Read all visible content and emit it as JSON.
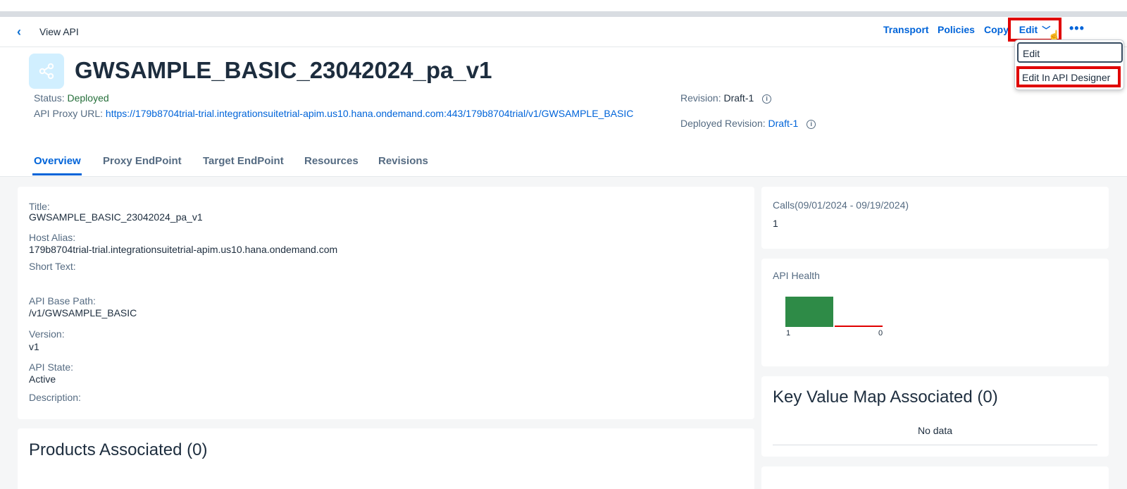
{
  "toolbar": {
    "view_title": "View API",
    "transport": "Transport",
    "policies": "Policies",
    "copy": "Copy",
    "edit": "Edit"
  },
  "dropdown": {
    "items": [
      "Edit",
      "Edit In API Designer"
    ]
  },
  "header": {
    "title": "GWSAMPLE_BASIC_23042024_pa_v1",
    "status_label": "Status:",
    "status_value": "Deployed",
    "proxy_url_label": "API Proxy URL:",
    "proxy_url": "https://179b8704trial-trial.integrationsuitetrial-apim.us10.hana.ondemand.com:443/179b8704trial/v1/GWSAMPLE_BASIC",
    "revision_label": "Revision:",
    "revision_value": "Draft-1",
    "deployed_revision_label": "Deployed Revision:",
    "deployed_revision_value": "Draft-1"
  },
  "tabs": [
    "Overview",
    "Proxy EndPoint",
    "Target EndPoint",
    "Resources",
    "Revisions"
  ],
  "details": {
    "title_label": "Title:",
    "title_value": "GWSAMPLE_BASIC_23042024_pa_v1",
    "host_alias_label": "Host Alias:",
    "host_alias_value": "179b8704trial-trial.integrationsuitetrial-apim.us10.hana.ondemand.com",
    "short_text_label": "Short Text:",
    "base_path_label": "API Base Path:",
    "base_path_value": "/v1/GWSAMPLE_BASIC",
    "version_label": "Version:",
    "version_value": "v1",
    "state_label": "API State:",
    "state_value": "Active",
    "description_label": "Description:"
  },
  "products": {
    "heading": "Products Associated (0)"
  },
  "calls": {
    "label": "Calls(09/01/2024 - 09/19/2024)",
    "value": "1"
  },
  "health": {
    "label": "API Health",
    "success_value": "1",
    "error_value": "0",
    "success_color": "#2e8b47",
    "error_color": "#e00000"
  },
  "kvm": {
    "heading": "Key Value Map Associated (0)",
    "empty_text": "No data"
  },
  "colors": {
    "accent": "#0064d9",
    "highlight": "#e00000",
    "positive": "#256f3a"
  }
}
